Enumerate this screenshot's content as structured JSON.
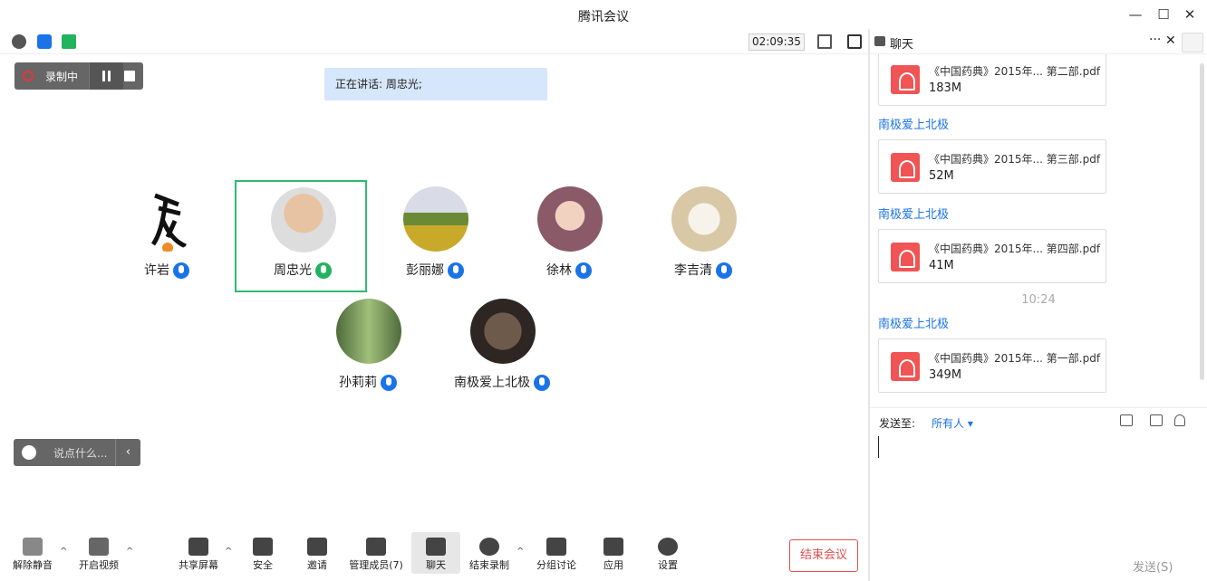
{
  "window": {
    "title": "腾讯会议",
    "min": "—",
    "max": "☐",
    "close": "✕"
  },
  "toolbar": {
    "timer": "02:09:35"
  },
  "recording": {
    "label": "录制中"
  },
  "speaking": {
    "text": "正在讲话: 周忠光;"
  },
  "participants": [
    {
      "name": "许岩"
    },
    {
      "name": "周忠光"
    },
    {
      "name": "彭丽娜"
    },
    {
      "name": "徐林"
    },
    {
      "name": "李吉清"
    },
    {
      "name": "孙莉莉"
    },
    {
      "name": "南极爱上北极"
    }
  ],
  "saybox": {
    "placeholder": "说点什么...",
    "collapse": "‹"
  },
  "bottombar": {
    "unmute": "解除静音",
    "video": "开启视频",
    "share": "共享屏幕",
    "security": "安全",
    "invite": "邀请",
    "members": "管理成员(7)",
    "chat": "聊天",
    "stop_record": "结束录制",
    "breakout": "分组讨论",
    "apps": "应用",
    "settings": "设置",
    "end": "结束会议",
    "caret": "^"
  },
  "chat": {
    "title": "聊天",
    "more": "···",
    "close": "✕",
    "messages": [
      {
        "file": "《中国药典》2015年... 第二部.pdf",
        "size": "183M"
      },
      {
        "sender": "南极爱上北极",
        "file": "《中国药典》2015年... 第三部.pdf",
        "size": "52M"
      },
      {
        "sender": "南极爱上北极",
        "file": "《中国药典》2015年... 第四部.pdf",
        "size": "41M"
      },
      {
        "sender": "南极爱上北极",
        "file": "《中国药典》2015年... 第一部.pdf",
        "size": "349M"
      }
    ],
    "time": "10:24",
    "send_to_label": "发送至:",
    "send_to": "所有人 ▾",
    "send": "发送(S)"
  }
}
